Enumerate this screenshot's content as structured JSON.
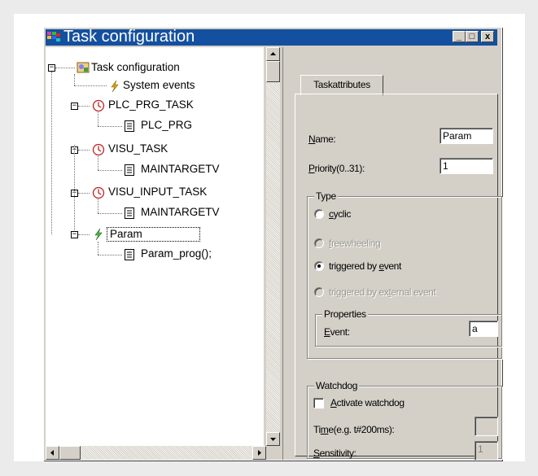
{
  "window": {
    "title": "Task configuration"
  },
  "title_buttons": {
    "minimize": "_",
    "maximize": "□",
    "close": "x"
  },
  "tree": {
    "root": "Task configuration",
    "items": [
      {
        "label": "System events",
        "icon": "lightning-icon"
      },
      {
        "label": "PLC_PRG_TASK",
        "icon": "clock-icon"
      },
      {
        "label": "PLC_PRG",
        "icon": "document-icon"
      },
      {
        "label": "VISU_TASK",
        "icon": "clock-icon"
      },
      {
        "label": "MAINTARGETV",
        "icon": "document-icon"
      },
      {
        "label": "VISU_INPUT_TASK",
        "icon": "clock-icon"
      },
      {
        "label": "MAINTARGETV",
        "icon": "document-icon"
      },
      {
        "label": "Param",
        "icon": "lightning-icon"
      },
      {
        "label": "Param_prog();",
        "icon": "document-icon"
      }
    ]
  },
  "tab": {
    "label": "Taskattributes"
  },
  "form": {
    "name_label_u": "N",
    "name_label_rest": "ame:",
    "name_value": "Param",
    "priority_label_u": "P",
    "priority_label_rest": "riority(0..31):",
    "priority_value": "1",
    "type_group": "Type",
    "opt_cyclic_u": "c",
    "opt_cyclic_rest": "yclic",
    "opt_free_u": "f",
    "opt_free_rest": "reewheeling",
    "opt_event_a": "triggered by ",
    "opt_event_u": "e",
    "opt_event_b": "vent",
    "opt_ext_a": "triggered by ex",
    "opt_ext_u": "t",
    "opt_ext_b": "ernal event",
    "properties_group": "Properties",
    "event_label_u": "E",
    "event_label_rest": "vent:",
    "event_value": "a",
    "watchdog_group": "Watchdog",
    "activate_u": "A",
    "activate_rest": "ctivate watchdog",
    "time_label_a": "Ti",
    "time_label_u": "m",
    "time_label_b": "e(e.g. t#200ms):",
    "time_value": "",
    "sensitivity_u": "S",
    "sensitivity_rest": "ensitivity:",
    "sensitivity_value": "1"
  }
}
